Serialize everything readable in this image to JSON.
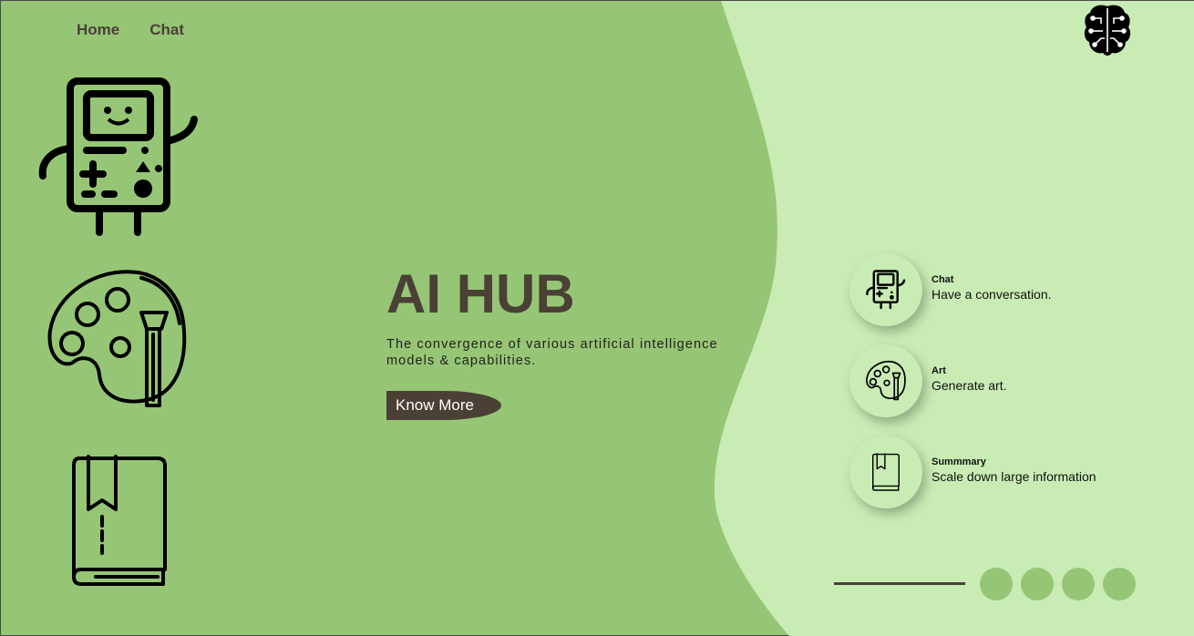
{
  "nav": {
    "home_label": "Home",
    "chat_label": "Chat"
  },
  "hero": {
    "title": "AI HUB",
    "subtitle": "The convergence of various artificial intelligence models & capabilities.",
    "cta_label": "Know More"
  },
  "features": [
    {
      "title": "Chat",
      "description": "Have a conversation.",
      "icon": "bmo-robot-icon"
    },
    {
      "title": "Art",
      "description": "Generate art.",
      "icon": "palette-icon"
    },
    {
      "title": "Summmary",
      "description": "Scale down large information",
      "icon": "book-icon"
    }
  ],
  "carousel": {
    "dot_count": 4
  },
  "colors": {
    "dark_green": "#96c675",
    "light_green": "#c9ecb4",
    "brown": "#4a4036"
  },
  "logo": {
    "icon": "brain-circuit-icon"
  }
}
